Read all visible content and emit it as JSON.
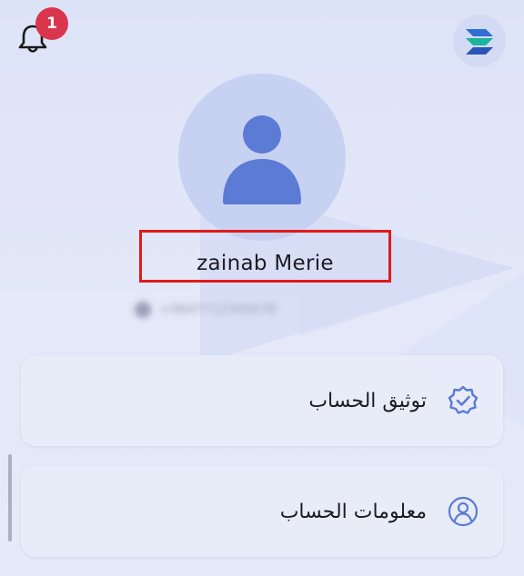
{
  "notifications": {
    "count": "1",
    "icon": "bell-icon"
  },
  "logo": {
    "icon": "app-logo-icon"
  },
  "profile": {
    "avatar_icon": "user-avatar-icon",
    "name": "zainab Merie",
    "phone": "+9647712345678"
  },
  "menu": {
    "items": [
      {
        "label": "توثيق الحساب",
        "icon": "verified-badge-icon"
      },
      {
        "label": "معلومات الحساب",
        "icon": "user-circle-icon"
      }
    ]
  },
  "colors": {
    "accent": "#5b7bd5",
    "badge": "#d9364d",
    "highlight_border": "#e01a1a",
    "background": "#dde3f7"
  }
}
